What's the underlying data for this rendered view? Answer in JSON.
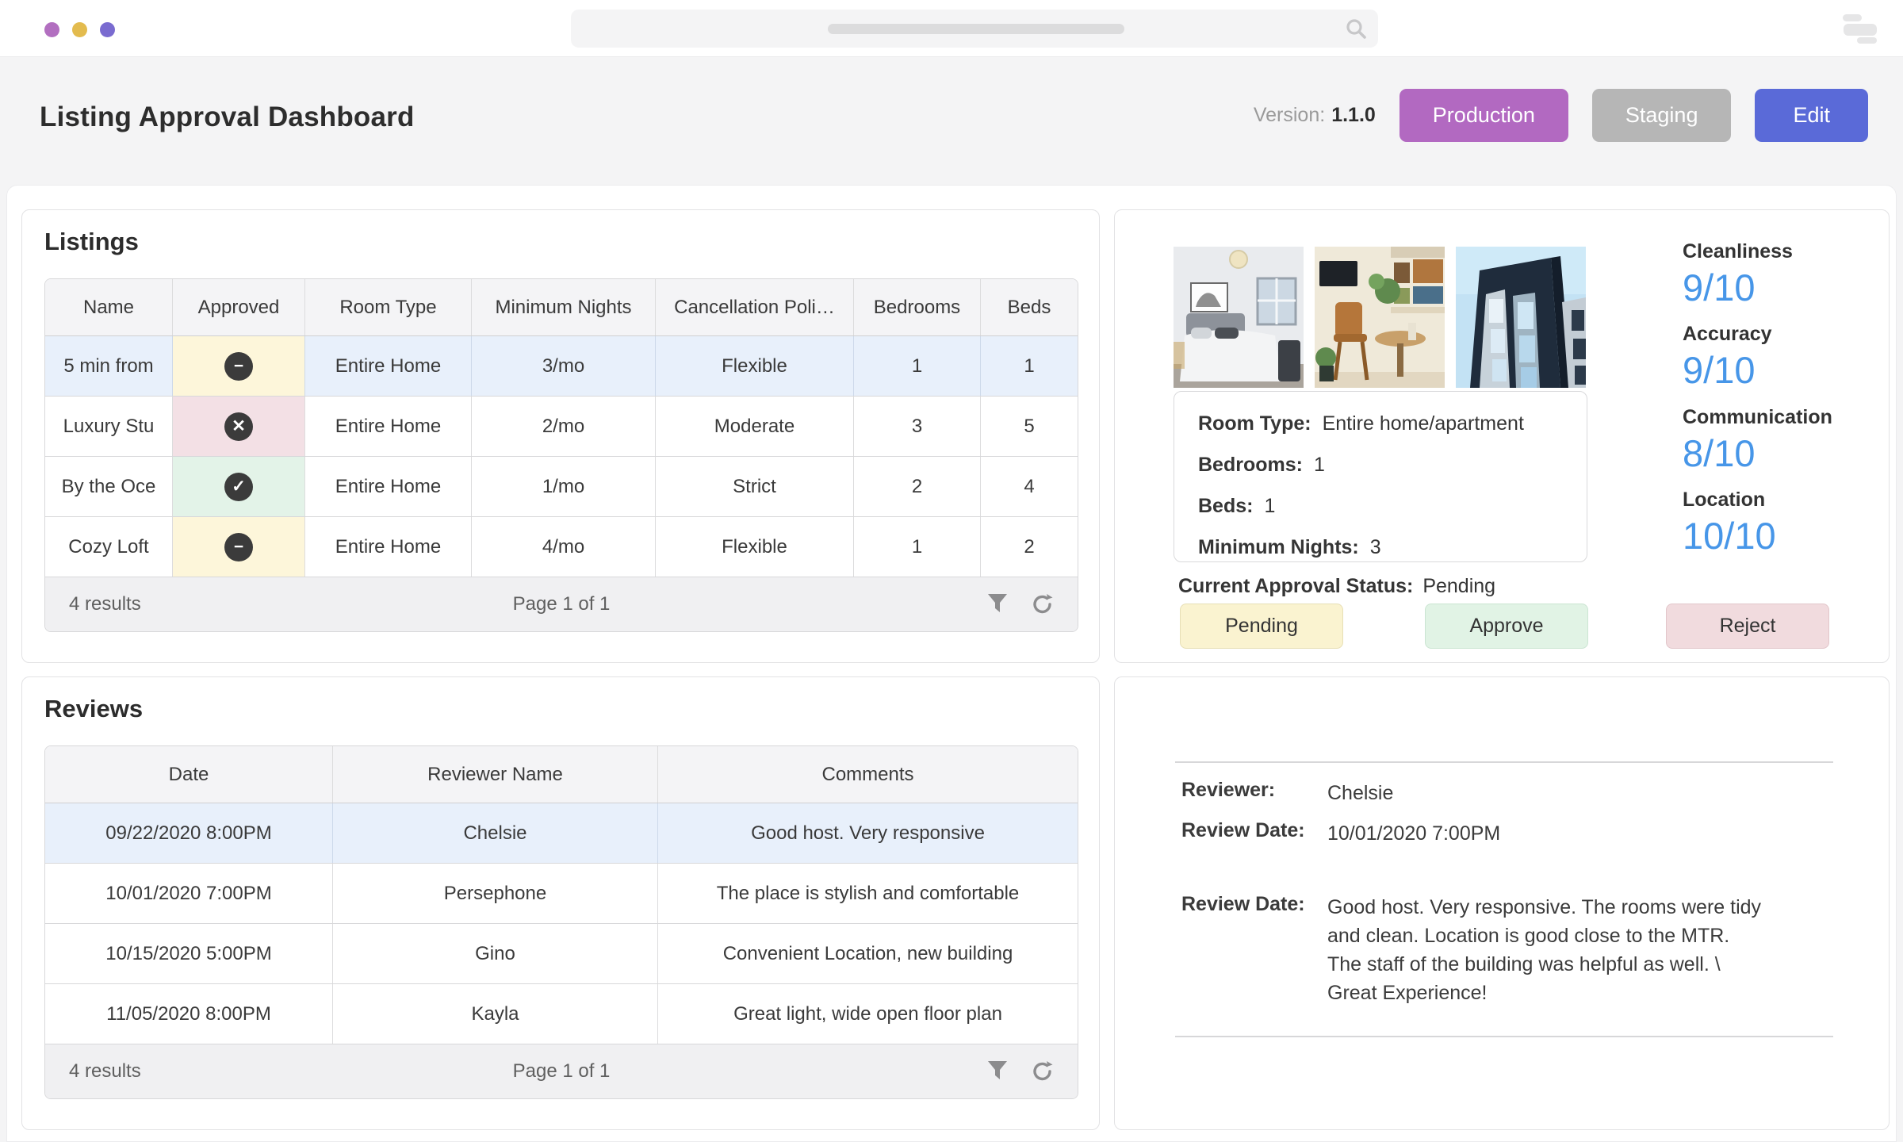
{
  "colors": {
    "production_button": "#b269c1",
    "staging_button": "#b6b6b6",
    "edit_button": "#5a6ad8",
    "rating_value": "#4796e8",
    "selected_row": "#e8f0fb",
    "pending_cell": "#fdf6da",
    "rejected_cell": "#f3e0e5",
    "approved_cell": "#e3f3e8",
    "pending_button": "#faf3d0",
    "approve_button": "#e1f3e5",
    "reject_button": "#f1dbde"
  },
  "header": {
    "title": "Listing Approval Dashboard",
    "version_label": "Version:",
    "version_value": "1.1.0",
    "production_label": "Production",
    "staging_label": "Staging",
    "edit_label": "Edit"
  },
  "listings": {
    "title": "Listings",
    "columns": {
      "name": "Name",
      "approved": "Approved",
      "room_type": "Room Type",
      "minimum_nights": "Minimum Nights",
      "cancellation": "Cancellation Poli…",
      "bedrooms": "Bedrooms",
      "beds": "Beds"
    },
    "rows": [
      {
        "name": "5 min from",
        "approved": "indeterminate",
        "approved_glyph": "−",
        "room_type": "Entire Home",
        "minimum_nights": "3/mo",
        "cancellation": "Flexible",
        "bedrooms": "1",
        "beds": "1",
        "selected": true
      },
      {
        "name": "Luxury Stu",
        "approved": "rejected",
        "approved_glyph": "✕",
        "room_type": "Entire Home",
        "minimum_nights": "2/mo",
        "cancellation": "Moderate",
        "bedrooms": "3",
        "beds": "5"
      },
      {
        "name": "By the Oce",
        "approved": "approved",
        "approved_glyph": "✓",
        "room_type": "Entire Home",
        "minimum_nights": "1/mo",
        "cancellation": "Strict",
        "bedrooms": "2",
        "beds": "4"
      },
      {
        "name": "Cozy Loft",
        "approved": "indeterminate",
        "approved_glyph": "−",
        "room_type": "Entire Home",
        "minimum_nights": "4/mo",
        "cancellation": "Flexible",
        "bedrooms": "1",
        "beds": "2"
      }
    ],
    "footer": {
      "results": "4 results",
      "page": "Page 1 of 1"
    }
  },
  "detail": {
    "ratings": [
      {
        "label": "Cleanliness",
        "value": "9/10"
      },
      {
        "label": "Accuracy",
        "value": "9/10"
      },
      {
        "label": "Communication",
        "value": "8/10"
      },
      {
        "label": "Location",
        "value": "10/10"
      }
    ],
    "info": [
      {
        "label": "Room Type:",
        "value": "Entire home/apartment"
      },
      {
        "label": "Bedrooms:",
        "value": "1"
      },
      {
        "label": "Beds:",
        "value": "1"
      },
      {
        "label": "Minimum Nights:",
        "value": "3"
      }
    ],
    "status_label": "Current Approval Status:",
    "status_value": "Pending",
    "actions": {
      "pending": "Pending",
      "approve": "Approve",
      "reject": "Reject"
    }
  },
  "reviews": {
    "title": "Reviews",
    "columns": {
      "date": "Date",
      "reviewer": "Reviewer Name",
      "comments": "Comments"
    },
    "rows": [
      {
        "date": "09/22/2020 8:00PM",
        "reviewer": "Chelsie",
        "comments": "Good host. Very responsive",
        "selected": true
      },
      {
        "date": "10/01/2020 7:00PM",
        "reviewer": "Persephone",
        "comments": "The place is stylish and comfortable"
      },
      {
        "date": "10/15/2020 5:00PM",
        "reviewer": "Gino",
        "comments": "Convenient Location, new building"
      },
      {
        "date": "11/05/2020 8:00PM",
        "reviewer": "Kayla",
        "comments": "Great light, wide open floor plan"
      }
    ],
    "footer": {
      "results": "4 results",
      "page": "Page 1 of 1"
    }
  },
  "review_detail": {
    "fields": [
      {
        "label": "Reviewer:",
        "value": "Chelsie"
      },
      {
        "label": "Review Date:",
        "value": "10/01/2020 7:00PM"
      },
      {
        "label": "Review Date:",
        "value": "Good host. Very responsive. The rooms were tidy\nand clean. Location is good close to the MTR.\nThe staff of the building was helpful as well. \\\nGreat Experience!"
      }
    ]
  }
}
